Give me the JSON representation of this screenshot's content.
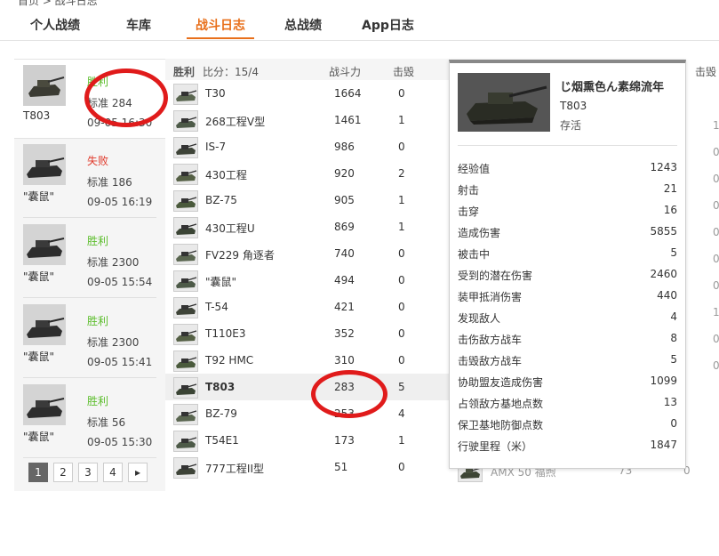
{
  "breadcrumb": "首页 > 战斗日志",
  "tabs": [
    {
      "label": "个人战绩"
    },
    {
      "label": "车库"
    },
    {
      "label": "战斗日志"
    },
    {
      "label": "总战绩"
    },
    {
      "label": "App日志"
    }
  ],
  "battles": [
    {
      "vehicle": "T803",
      "result": "胜利",
      "score": "标准 284",
      "time": "09-05 16:30"
    },
    {
      "vehicle": "\"囊鼠\"",
      "result": "失败",
      "score": "标准 186",
      "time": "09-05 16:19"
    },
    {
      "vehicle": "\"囊鼠\"",
      "result": "胜利",
      "score": "标准 2300",
      "time": "09-05 15:54"
    },
    {
      "vehicle": "\"囊鼠\"",
      "result": "胜利",
      "score": "标准 2300",
      "time": "09-05 15:41"
    },
    {
      "vehicle": "\"囊鼠\"",
      "result": "胜利",
      "score": "标准 56",
      "time": "09-05 15:30"
    }
  ],
  "pager": {
    "pages": [
      "1",
      "2",
      "3",
      "4"
    ],
    "next": "▸"
  },
  "team": {
    "result": "胜利",
    "score": "比分：15/4",
    "col_power": "战斗力",
    "col_kills": "击毁",
    "rows": [
      {
        "name": "T30",
        "power": "1664",
        "kills": "0"
      },
      {
        "name": "268工程V型",
        "power": "1461",
        "kills": "1"
      },
      {
        "name": "IS-7",
        "power": "986",
        "kills": "0"
      },
      {
        "name": "430工程",
        "power": "920",
        "kills": "2"
      },
      {
        "name": "BZ-75",
        "power": "905",
        "kills": "1"
      },
      {
        "name": "430工程U",
        "power": "869",
        "kills": "1"
      },
      {
        "name": "FV229 角逐者",
        "power": "740",
        "kills": "0"
      },
      {
        "name": "\"囊鼠\"",
        "power": "494",
        "kills": "0"
      },
      {
        "name": "T-54",
        "power": "421",
        "kills": "0"
      },
      {
        "name": "T110E3",
        "power": "352",
        "kills": "0"
      },
      {
        "name": "T92 HMC",
        "power": "310",
        "kills": "0"
      },
      {
        "name": "T803",
        "power": "283",
        "kills": "5"
      },
      {
        "name": "BZ-79",
        "power": "253",
        "kills": "4"
      },
      {
        "name": "T54E1",
        "power": "173",
        "kills": "1"
      },
      {
        "name": "777工程II型",
        "power": "51",
        "kills": "0"
      }
    ]
  },
  "enemy_partial": {
    "col_kills": "击毁",
    "side_values": [
      "1",
      "0",
      "0",
      "0",
      "0",
      "0",
      "0",
      "1",
      "0",
      "0"
    ],
    "last_row": {
      "name": "AMX 50 福煦",
      "power": "73",
      "kills": "0"
    }
  },
  "popup": {
    "player": "じ烟熏色ん素绵流年",
    "tank": "T803",
    "status": "存活",
    "stats": [
      {
        "label": "经验值",
        "value": "1243"
      },
      {
        "label": "射击",
        "value": "21"
      },
      {
        "label": "击穿",
        "value": "16"
      },
      {
        "label": "造成伤害",
        "value": "5855"
      },
      {
        "label": "被击中",
        "value": "5"
      },
      {
        "label": "受到的潜在伤害",
        "value": "2460"
      },
      {
        "label": "装甲抵消伤害",
        "value": "440"
      },
      {
        "label": "发现敌人",
        "value": "4"
      },
      {
        "label": "击伤敌方战车",
        "value": "8"
      },
      {
        "label": "击毁敌方战车",
        "value": "5"
      },
      {
        "label": "协助盟友造成伤害",
        "value": "1099"
      },
      {
        "label": "占领敌方基地点数",
        "value": "13"
      },
      {
        "label": "保卫基地防御点数",
        "value": "0"
      },
      {
        "label": "行驶里程（米）",
        "value": "1847"
      }
    ]
  }
}
